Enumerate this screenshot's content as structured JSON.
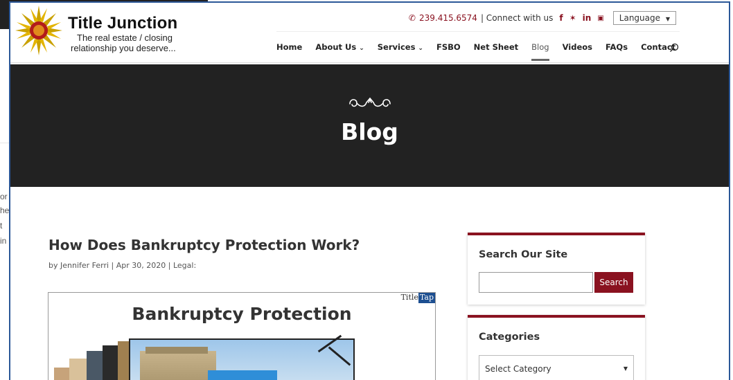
{
  "header": {
    "logo_title": "Title Junction",
    "logo_tagline_1": "The real estate / closing",
    "logo_tagline_2": "relationship you deserve...",
    "phone": "239.415.6574",
    "connect_text": "| Connect with us",
    "social": [
      "f",
      "t",
      "in",
      "yt"
    ],
    "language_label": "Language"
  },
  "nav": {
    "items": [
      {
        "label": "Home",
        "dropdown": false
      },
      {
        "label": "About Us",
        "dropdown": true
      },
      {
        "label": "Services",
        "dropdown": true
      },
      {
        "label": "FSBO",
        "dropdown": false
      },
      {
        "label": "Net Sheet",
        "dropdown": false
      },
      {
        "label": "Blog",
        "dropdown": false,
        "active": true
      },
      {
        "label": "Videos",
        "dropdown": false
      },
      {
        "label": "FAQs",
        "dropdown": false
      },
      {
        "label": "Contact",
        "dropdown": false
      }
    ],
    "icons": {
      "search": "search-icon"
    }
  },
  "hero": {
    "title": "Blog"
  },
  "post": {
    "title": "How Does Bankruptcy Protection Work?",
    "meta": "by Jennifer Ferri | Apr 30, 2020 | Legal:",
    "image_heading": "Bankruptcy Protection",
    "image_brand_a": "Title",
    "image_brand_b": "Tap"
  },
  "sidebar": {
    "search_title": "Search Our Site",
    "search_button": "Search",
    "categories_title": "Categories",
    "categories_select": "Select Category"
  },
  "background_page": {
    "fragments": [
      "or",
      "he",
      "t",
      "in"
    ]
  },
  "colors": {
    "accent": "#8a1220",
    "frame": "#2b5797",
    "hero_bg": "#222222"
  }
}
